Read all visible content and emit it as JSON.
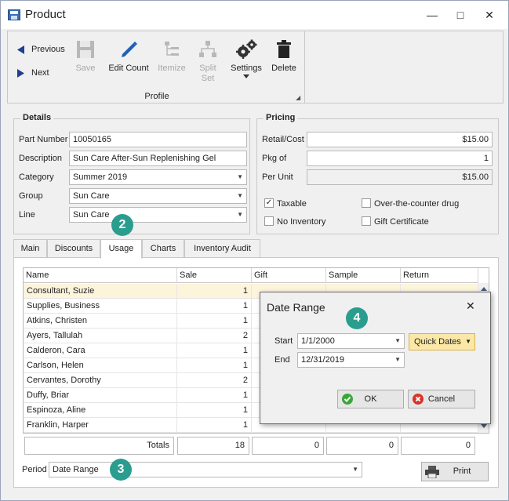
{
  "window": {
    "title": "Product",
    "controls": [
      "minimize",
      "maximize",
      "close"
    ]
  },
  "ribbon": {
    "nav": {
      "previous": "Previous",
      "next": "Next"
    },
    "buttons": [
      {
        "label": "Save",
        "enabled": false,
        "icon": "floppy-disk-icon"
      },
      {
        "label": "Edit Count",
        "enabled": true,
        "icon": "pencil-icon"
      },
      {
        "label": "Itemize",
        "enabled": false,
        "icon": "itemize-icon"
      },
      {
        "label": "Split\nSet",
        "enabled": false,
        "icon": "hierarchy-icon"
      },
      {
        "label": "Settings",
        "enabled": true,
        "icon": "gears-icon"
      },
      {
        "label": "Delete",
        "enabled": true,
        "icon": "trash-icon"
      }
    ],
    "group_label": "Profile"
  },
  "details": {
    "title": "Details",
    "part_number_label": "Part Number",
    "part_number": "10050165",
    "description_label": "Description",
    "description": "Sun Care After-Sun Replenishing Gel",
    "category_label": "Category",
    "category": "Summer 2019",
    "group_label": "Group",
    "group": "Sun Care",
    "line_label": "Line",
    "line": "Sun Care"
  },
  "pricing": {
    "title": "Pricing",
    "retail_label": "Retail/Cost",
    "retail": "$15.00",
    "pkg_label": "Pkg of",
    "pkg": "1",
    "per_unit_label": "Per Unit",
    "per_unit": "$15.00",
    "taxable_label": "Taxable",
    "taxable": true,
    "no_inventory_label": "No Inventory",
    "no_inventory": false,
    "otc_label": "Over-the-counter drug",
    "otc": false,
    "gift_cert_label": "Gift Certificate",
    "gift_cert": false
  },
  "tabs": [
    "Main",
    "Discounts",
    "Usage",
    "Charts",
    "Inventory Audit"
  ],
  "active_tab": "Usage",
  "grid": {
    "columns": [
      "Name",
      "Sale",
      "Gift",
      "Sample",
      "Return"
    ],
    "rows": [
      {
        "name": "Consultant, Suzie",
        "sale": "1"
      },
      {
        "name": "Supplies, Business",
        "sale": "1"
      },
      {
        "name": "Atkins, Christen",
        "sale": "1"
      },
      {
        "name": "Ayers, Tallulah",
        "sale": "2"
      },
      {
        "name": "Calderon, Cara",
        "sale": "1"
      },
      {
        "name": "Carlson, Helen",
        "sale": "1"
      },
      {
        "name": "Cervantes, Dorothy",
        "sale": "2"
      },
      {
        "name": "Duffy, Briar",
        "sale": "1"
      },
      {
        "name": "Espinoza, Aline",
        "sale": "1"
      },
      {
        "name": "Franklin, Harper",
        "sale": "1"
      }
    ],
    "totals_label": "Totals",
    "totals": {
      "sale": "18",
      "gift": "0",
      "sample": "0",
      "return": "0"
    }
  },
  "period": {
    "label": "Period",
    "value": "Date Range"
  },
  "print_label": "Print",
  "badges": [
    "2",
    "3",
    "4"
  ],
  "dialog": {
    "title": "Date Range",
    "start_label": "Start",
    "start": "1/1/2000",
    "end_label": "End",
    "end": "12/31/2019",
    "quick_dates": "Quick Dates",
    "ok": "OK",
    "cancel": "Cancel"
  },
  "colors": {
    "badge": "#2a9d8f",
    "selected_row": "#fdf4dc",
    "quick_dates_bg": "#fbe8a6",
    "ok_icon": "#3aa63a",
    "cancel_icon": "#d9342b"
  }
}
